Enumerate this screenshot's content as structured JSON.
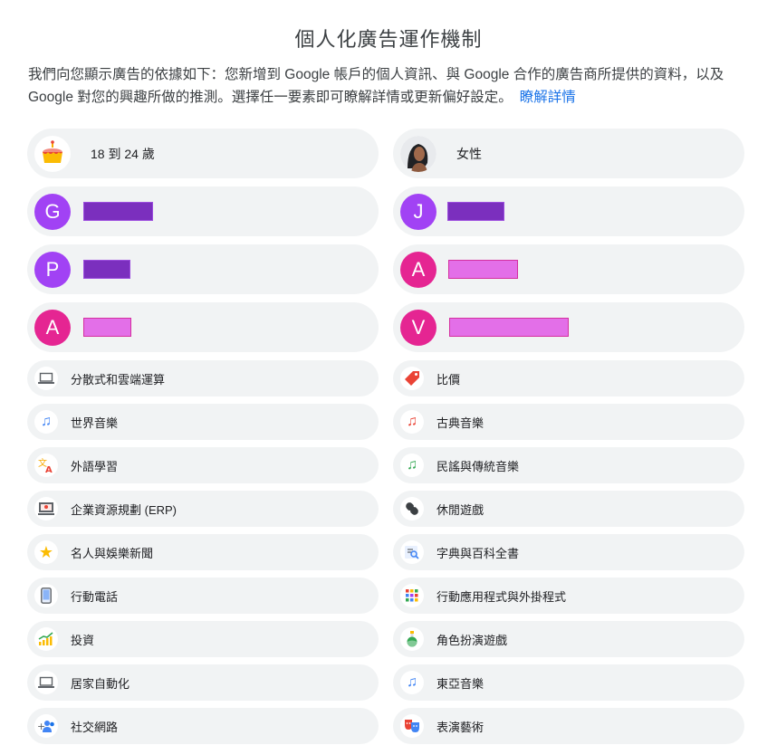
{
  "page": {
    "title": "個人化廣告運作機制",
    "intro": "我們向您顯示廣告的依據如下：您新增到 Google 帳戶的個人資訊、與 Google 合作的廣告商所提供的資料，以及 Google 對您的興趣所做的推測。選擇任一要素即可瞭解詳情或更新偏好設定。",
    "learn_more": "瞭解詳情"
  },
  "profile": {
    "age": "18 到 24 歲",
    "gender": "女性"
  },
  "advertisers": [
    {
      "initial": "G",
      "color": "#a142f4",
      "redact_color": "#7b2fbe"
    },
    {
      "initial": "J",
      "color": "#a142f4",
      "redact_color": "#7b2fbe"
    },
    {
      "initial": "P",
      "color": "#a142f4",
      "redact_color": "#7b2fbe"
    },
    {
      "initial": "A",
      "color": "#e52592",
      "redact_color": "#e36fe8"
    },
    {
      "initial": "A",
      "color": "#e52592",
      "redact_color": "#e36fe8"
    },
    {
      "initial": "V",
      "color": "#e52592",
      "redact_color": "#e36fe8"
    }
  ],
  "topics_left": [
    {
      "label": "分散式和雲端運算",
      "icon": "laptop-icon"
    },
    {
      "label": "世界音樂",
      "icon": "music-note-icon"
    },
    {
      "label": "外語學習",
      "icon": "translate-icon"
    },
    {
      "label": "企業資源規劃 (ERP)",
      "icon": "presentation-icon"
    },
    {
      "label": "名人與娛樂新聞",
      "icon": "star-icon"
    },
    {
      "label": "行動電話",
      "icon": "phone-icon"
    },
    {
      "label": "投資",
      "icon": "chart-icon"
    },
    {
      "label": "居家自動化",
      "icon": "laptop-icon"
    },
    {
      "label": "社交網路",
      "icon": "people-icon"
    }
  ],
  "topics_right": [
    {
      "label": "比價",
      "icon": "price-tag-icon"
    },
    {
      "label": "古典音樂",
      "icon": "music-note-icon"
    },
    {
      "label": "民謠與傳統音樂",
      "icon": "music-note-icon"
    },
    {
      "label": "休閒遊戲",
      "icon": "gamepad-icon"
    },
    {
      "label": "字典與百科全書",
      "icon": "book-search-icon"
    },
    {
      "label": "行動應用程式與外掛程式",
      "icon": "apps-grid-icon"
    },
    {
      "label": "角色扮演遊戲",
      "icon": "potion-icon"
    },
    {
      "label": "東亞音樂",
      "icon": "music-note-icon"
    },
    {
      "label": "表演藝術",
      "icon": "theater-masks-icon"
    }
  ]
}
